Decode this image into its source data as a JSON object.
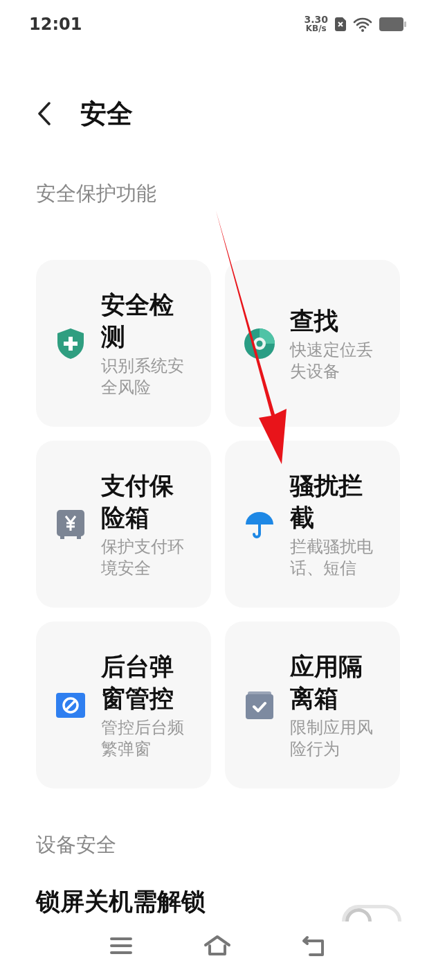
{
  "status_bar": {
    "time": "12:01",
    "speed_value": "3.30",
    "speed_unit": "KB/s"
  },
  "header": {
    "title": "安全"
  },
  "sections": [
    {
      "title": "安全保护功能",
      "cards": [
        {
          "title": "安全检测",
          "subtitle": "识别系统安全风险"
        },
        {
          "title": "查找",
          "subtitle": "快速定位丢失设备"
        },
        {
          "title": "支付保险箱",
          "subtitle": "保护支付环境安全"
        },
        {
          "title": "骚扰拦截",
          "subtitle": "拦截骚扰电话、短信"
        },
        {
          "title": "后台弹窗管控",
          "subtitle": "管控后台频繁弹窗"
        },
        {
          "title": "应用隔离箱",
          "subtitle": "限制应用风险行为"
        }
      ]
    },
    {
      "title": "设备安全",
      "rows": [
        {
          "label": "锁屏关机需解锁",
          "on": false
        }
      ]
    }
  ]
}
